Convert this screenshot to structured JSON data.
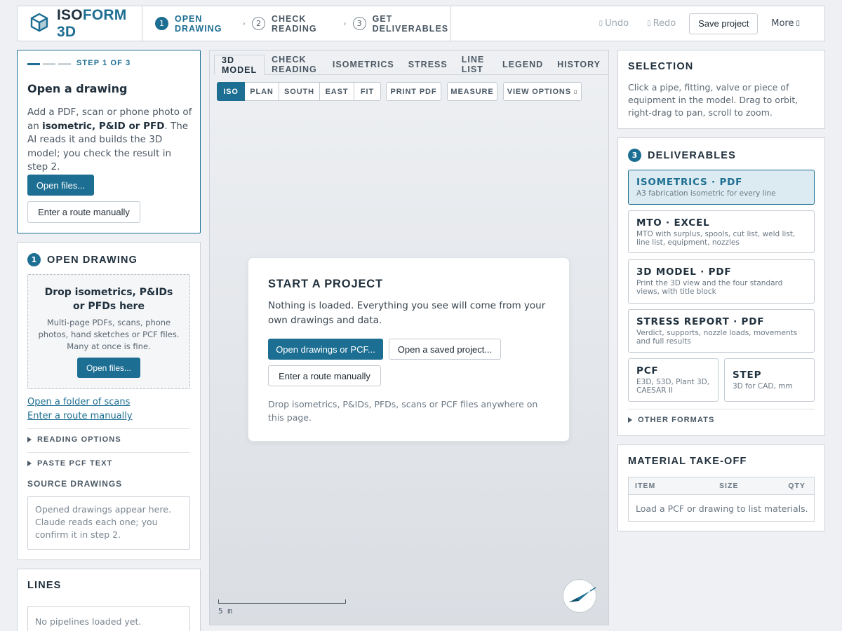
{
  "app": {
    "brand_a": "ISO",
    "brand_b": "FORM 3D"
  },
  "wizard": [
    {
      "n": "1",
      "label": "OPEN DRAWING"
    },
    {
      "n": "2",
      "label": "CHECK READING"
    },
    {
      "n": "3",
      "label": "GET DELIVERABLES"
    }
  ],
  "toolbar": {
    "undo": "Undo",
    "redo": "Redo",
    "save": "Save project",
    "more": "More"
  },
  "step_card": {
    "progress": "STEP 1 OF 3",
    "title": "Open a drawing",
    "body_a": "Add a PDF, scan or phone photo of an ",
    "body_b": "isometric, P&ID or PFD",
    "body_c": ". The AI reads it and builds the 3D model; you check the result in step 2.",
    "open_files": "Open files...",
    "manual": "Enter a route manually"
  },
  "open_drawing": {
    "num": "1",
    "title": "OPEN DRAWING",
    "drop_title": "Drop isometrics, P&IDs or PFDs here",
    "drop_text": "Multi-page PDFs, scans, phone photos, hand sketches or PCF files. Many at once is fine.",
    "open_files": "Open files...",
    "folder_link": "Open a folder of scans",
    "manual_link": "Enter a route manually",
    "reading_options": "READING OPTIONS",
    "paste_pcf": "PASTE PCF TEXT",
    "source_title": "SOURCE DRAWINGS",
    "source_text": "Opened drawings appear here. Claude reads each one; you confirm it in step 2."
  },
  "lines": {
    "title": "LINES",
    "empty": "No pipelines loaded yet."
  },
  "tabs": [
    "3D MODEL",
    "CHECK READING",
    "ISOMETRICS",
    "STRESS",
    "LINE LIST",
    "LEGEND",
    "HISTORY"
  ],
  "views": [
    "ISO",
    "PLAN",
    "SOUTH",
    "EAST",
    "FIT"
  ],
  "view_tools": {
    "print": "PRINT PDF",
    "measure": "MEASURE",
    "options": "VIEW OPTIONS"
  },
  "start": {
    "title": "START A PROJECT",
    "text": "Nothing is loaded. Everything you see will come from your own drawings and data.",
    "open_btn": "Open drawings or PCF...",
    "saved_btn": "Open a saved project...",
    "manual_btn": "Enter a route manually",
    "hint": "Drop isometrics, P&IDs, PFDs, scans or PCF files anywhere on this page."
  },
  "scale": {
    "label": "5 m"
  },
  "selection": {
    "title": "SELECTION",
    "text": "Click a pipe, fitting, valve or piece of equipment in the model. Drag to orbit, right-drag to pan, scroll to zoom."
  },
  "deliverables": {
    "num": "3",
    "title": "DELIVERABLES",
    "items": [
      {
        "title": "ISOMETRICS · PDF",
        "desc": "A3 fabrication isometric for every line"
      },
      {
        "title": "MTO · EXCEL",
        "desc": "MTO with surplus, spools, cut list, weld list, line list, equipment, nozzles"
      },
      {
        "title": "3D MODEL · PDF",
        "desc": "Print the 3D view and the four standard views, with title block"
      },
      {
        "title": "STRESS REPORT · PDF",
        "desc": "Verdict, supports, nozzle loads, movements and full results"
      }
    ],
    "pcf": {
      "title": "PCF",
      "desc": "E3D, S3D, Plant 3D, CAESAR II"
    },
    "step": {
      "title": "STEP",
      "desc": "3D for CAD, mm"
    },
    "other": "OTHER FORMATS"
  },
  "mto": {
    "title": "MATERIAL TAKE-OFF",
    "columns": [
      "ITEM",
      "SIZE",
      "QTY"
    ],
    "empty": "Load a PCF or drawing to list materials."
  },
  "icons": [
    "isoform-logo-icon",
    "undo-icon",
    "redo-icon",
    "chevron-down-icon",
    "compass-icon"
  ]
}
